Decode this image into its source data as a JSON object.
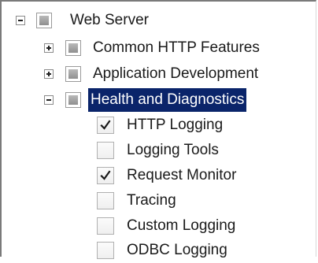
{
  "tree": {
    "root": {
      "label": "Web Server",
      "expanded": true,
      "state": "partial"
    },
    "groups": [
      {
        "label": "Common HTTP Features",
        "expanded": false,
        "state": "partial",
        "selected": false
      },
      {
        "label": "Application Development",
        "expanded": false,
        "state": "partial",
        "selected": false
      },
      {
        "label": "Health and Diagnostics",
        "expanded": true,
        "state": "partial",
        "selected": true
      }
    ],
    "items": [
      {
        "label": "HTTP Logging",
        "checked": true
      },
      {
        "label": "Logging Tools",
        "checked": false
      },
      {
        "label": "Request Monitor",
        "checked": true
      },
      {
        "label": "Tracing",
        "checked": false
      },
      {
        "label": "Custom Logging",
        "checked": false
      },
      {
        "label": "ODBC Logging",
        "checked": false
      }
    ]
  },
  "colors": {
    "selection_bg": "#0a246a",
    "selection_fg": "#ffffff"
  }
}
